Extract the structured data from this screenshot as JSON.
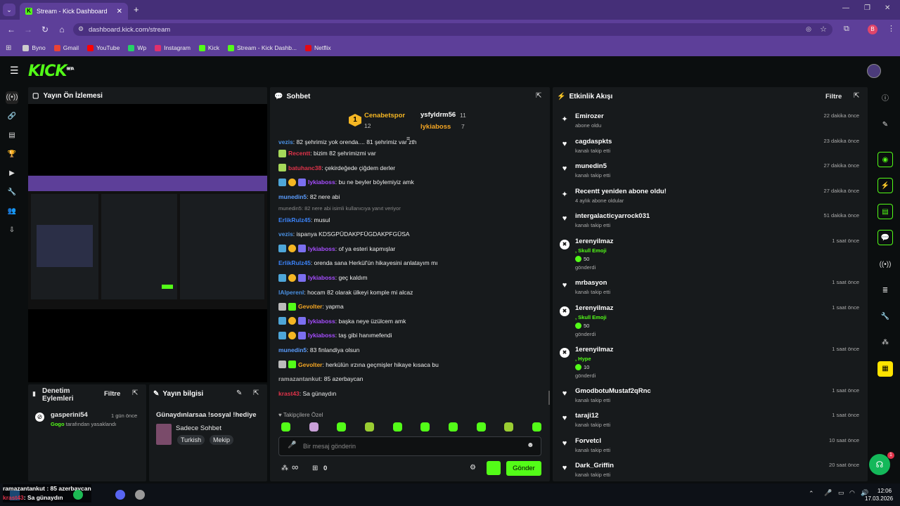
{
  "browser": {
    "tab_title": "Stream - Kick Dashboard",
    "url": "dashboard.kick.com/stream",
    "profile_initial": "B",
    "bookmarks": [
      {
        "label": "Byno",
        "color": "#cccccc"
      },
      {
        "label": "Gmail",
        "color": "#ea4335"
      },
      {
        "label": "YouTube",
        "color": "#ff0000"
      },
      {
        "label": "Wp",
        "color": "#25d366"
      },
      {
        "label": "Instagram",
        "color": "#e1306c"
      },
      {
        "label": "Kick",
        "color": "#53fc18"
      },
      {
        "label": "Stream - Kick Dashb...",
        "color": "#53fc18"
      },
      {
        "label": "Netflix",
        "color": "#e50914"
      }
    ]
  },
  "app": {
    "logo": "KICK",
    "beta": "BETA",
    "accent": "#53fc18"
  },
  "preview": {
    "title": "Yayın Ön İzlemesi"
  },
  "moderation": {
    "title": "Denetim Eylemleri",
    "filter": "Filtre",
    "entry": {
      "user": "gasperini54",
      "time": "1 gün önce",
      "actor": "Gogo",
      "action": "tarafından yasaklandı"
    }
  },
  "stream_info": {
    "title": "Yayın bilgisi",
    "stream_title": "Günaydınlarsaa !sosyal !hediye",
    "category": "Sadece Sohbet",
    "tags": [
      "Turkish",
      "Mekip"
    ]
  },
  "chat": {
    "title": "Sohbet",
    "leaderboard": [
      {
        "name": "Cenabetspor",
        "count": "12",
        "rank": "1"
      },
      {
        "name": "ysfyldrm56",
        "count": "11"
      },
      {
        "name": "lykiaboss",
        "count": "7"
      }
    ],
    "messages": [
      {
        "user": "vezis",
        "color": "#4a90e2",
        "text": ": 82 şehrimiz yok orenda.... 81 şehrimiz var zth",
        "badges": 0
      },
      {
        "user": "Recentt",
        "color": "#e0334a",
        "text": ": bizim 82 şehrimizmi var",
        "badges": 1
      },
      {
        "user": "batuhanc38",
        "color": "#e0334a",
        "text": ": çekirdeğede çiğdem derler",
        "badges": 1
      },
      {
        "user": "lykiaboss",
        "color": "#a64dff",
        "text": ": bu ne beyler böylemiyiz amk",
        "badges": 3
      },
      {
        "user": "munedin5",
        "color": "#5b9dff",
        "text": ": 82 nere abi",
        "badges": 0
      },
      {
        "user": "ErlikRulz45",
        "color": "#3b82f6",
        "text": ": musul",
        "badges": 0,
        "reply": "munedin5: 82 nere abi isimli kullanıcıya yanıt veriyor"
      },
      {
        "user": "vezis",
        "color": "#4a90e2",
        "text": ": ispanya KDSGPÜDAKPFÜGDAKPFGÜSA",
        "badges": 0
      },
      {
        "user": "lykiaboss",
        "color": "#a64dff",
        "text": ": of ya esteri kapmışlar",
        "badges": 3
      },
      {
        "user": "ErlikRulz45",
        "color": "#3b82f6",
        "text": ": orenda sana Herkül'ün hikayesini anlatayım mı",
        "badges": 0
      },
      {
        "user": "lykiaboss",
        "color": "#a64dff",
        "text": ": geç kaldım",
        "badges": 3
      },
      {
        "user": "lAlperenl",
        "color": "#4a90e2",
        "text": ": hocam 82 olarak ülkeyi komple mi alcaz",
        "badges": 0
      },
      {
        "user": "Gevolter",
        "color": "#f5a623",
        "text": ": yapma",
        "badges": 2
      },
      {
        "user": "lykiaboss",
        "color": "#a64dff",
        "text": ": başka neye üzülcem amk",
        "badges": 3
      },
      {
        "user": "lykiaboss",
        "color": "#a64dff",
        "text": ": taş gibi hanımefendi",
        "badges": 3
      },
      {
        "user": "munedin5",
        "color": "#5b9dff",
        "text": ": 83 finlandiya olsun",
        "badges": 0
      },
      {
        "user": "Gevolter",
        "color": "#f5a623",
        "text": ": herkülün ırzına geçmişler hikaye kısaca bu",
        "badges": 2
      },
      {
        "user": "ramazantankut",
        "color": "#aaaaaa",
        "text": ": 85 azerbaycan",
        "badges": 0
      },
      {
        "user": "krast43",
        "color": "#e0334a",
        "text": ": Sa günaydın",
        "badges": 0
      }
    ],
    "emote_label": "Takipçilere Özel",
    "input_placeholder": "Bir mesaj gönderin",
    "infinity": "∞",
    "gift_count": "0",
    "send": "Gönder"
  },
  "activity": {
    "title": "Etkinlik Akışı",
    "filter": "Filtre",
    "events": [
      {
        "icon": "sparkle-icon",
        "name": "Emirozer",
        "sub": "abone oldu",
        "time": "22 dakika önce"
      },
      {
        "icon": "heart-icon",
        "name": "cagdaspkts",
        "sub": "kanalı takip etti",
        "time": "23 dakika önce"
      },
      {
        "icon": "heart-icon",
        "name": "munedin5",
        "sub": "kanalı takip etti",
        "time": "27 dakika önce"
      },
      {
        "icon": "sparkle-icon",
        "name": "Recentt yeniden abone oldu!",
        "sub": "4 aylık abone oldular",
        "time": "27 dakika önce"
      },
      {
        "icon": "heart-icon",
        "name": "intergalacticyarrock031",
        "sub": "kanalı takip etti",
        "time": "51 dakika önce"
      },
      {
        "icon": "kick-icon",
        "name": "1erenyilmaz",
        "kicks": ", Skull Emoji",
        "amount": "50",
        "sub": "gönderdi",
        "time": "1 saat önce"
      },
      {
        "icon": "heart-icon",
        "name": "mrbasyon",
        "sub": "kanalı takip etti",
        "time": "1 saat önce"
      },
      {
        "icon": "kick-icon",
        "name": "1erenyilmaz",
        "kicks": ", Skull Emoji",
        "amount": "50",
        "sub": "gönderdi",
        "time": "1 saat önce"
      },
      {
        "icon": "kick-icon",
        "name": "1erenyilmaz",
        "kicks": ", Hype",
        "amount": "10",
        "sub": "gönderdi",
        "time": "1 saat önce"
      },
      {
        "icon": "heart-icon",
        "name": "GmodbotuMustaf2qRnc",
        "sub": "kanalı takip etti",
        "time": "1 saat önce"
      },
      {
        "icon": "heart-icon",
        "name": "taraji12",
        "sub": "kanalı takip etti",
        "time": "1 saat önce"
      },
      {
        "icon": "heart-icon",
        "name": "Forvetcl",
        "sub": "kanalı takip etti",
        "time": "10 saat önce"
      },
      {
        "icon": "heart-icon",
        "name": "Dark_Griffin",
        "sub": "kanalı takip etti",
        "time": "20 saat önce"
      }
    ]
  },
  "taskbar": {
    "notif_line1": "ramazantankut : 85 azerbaycan",
    "notif_user": "krast43",
    "notif_line2": ": Sa günaydın",
    "time": "12:06",
    "date": "17.03.2026"
  },
  "support_badge": "1"
}
